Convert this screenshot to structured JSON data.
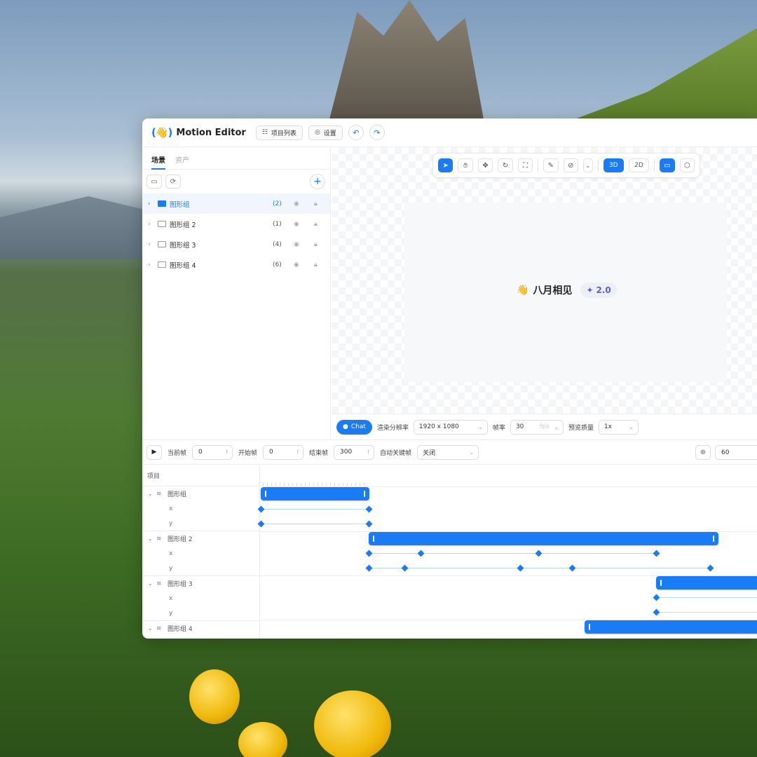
{
  "app": {
    "logo_mark": "(👋)",
    "title": "Motion Editor",
    "project_list_label": "项目列表",
    "settings_label": "设置"
  },
  "left_panel": {
    "tabs": [
      {
        "label": "场景",
        "active": true
      },
      {
        "label": "资产",
        "active": false
      }
    ],
    "tree": [
      {
        "label": "图形组",
        "count": "(2)",
        "selected": true
      },
      {
        "label": "图形组 2",
        "count": "(1)",
        "selected": false
      },
      {
        "label": "图形组 3",
        "count": "(4)",
        "selected": false
      },
      {
        "label": "图形组 4",
        "count": "(6)",
        "selected": false
      }
    ]
  },
  "canvas": {
    "toolbar": {
      "mode_3d": "3D",
      "mode_2d": "2D",
      "active_mode": "3D"
    },
    "stage_emoji": "👋",
    "stage_title": "八月相见",
    "badge_label": "2.0"
  },
  "render_bar": {
    "chat_label": "Chat",
    "resolution_label": "渲染分辨率",
    "resolution_value": "1920 x 1080",
    "fps_label": "帧率",
    "fps_value": "30",
    "fps_unit": "fps",
    "quality_label": "预览质量",
    "quality_value": "1x"
  },
  "timeline_controls": {
    "current_frame_label": "当前帧",
    "current_frame_value": "0",
    "start_frame_label": "开始帧",
    "start_frame_value": "0",
    "end_frame_label": "结束帧",
    "end_frame_value": "300",
    "frame_unit": "f",
    "auto_keyframe_label": "自动关键帧",
    "auto_keyframe_value": "关闭",
    "zoom_value": "60"
  },
  "timeline": {
    "header_label": "项目",
    "groups": [
      {
        "label": "图形组",
        "props": [
          "x",
          "y"
        ]
      },
      {
        "label": "图形组 2",
        "props": [
          "x",
          "y"
        ]
      },
      {
        "label": "图形组 3",
        "props": [
          "x",
          "y"
        ]
      },
      {
        "label": "图形组 4",
        "props": []
      }
    ]
  },
  "colors": {
    "accent": "#1a7cf5",
    "badge_text": "#5b5fd6",
    "selected_row_bg": "#f1f6fe"
  }
}
